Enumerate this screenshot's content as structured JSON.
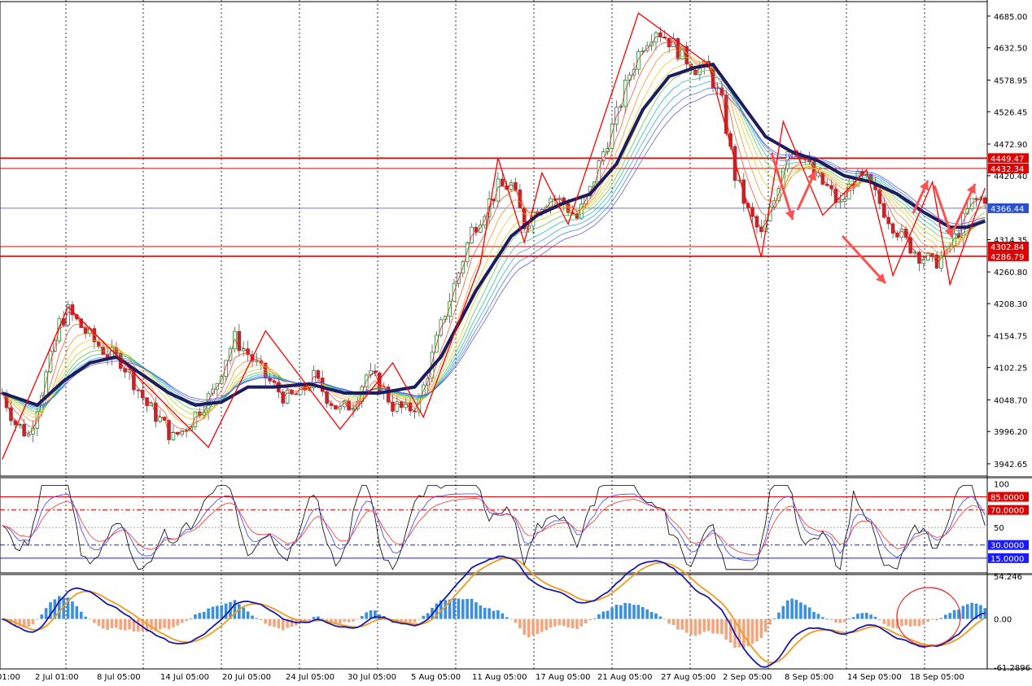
{
  "chart_data": [
    {
      "panel": "price",
      "type": "candlestick",
      "y_ticks": [
        "4685.00",
        "4632.50",
        "4578.95",
        "4526.45",
        "4472.90",
        "4420.40",
        "4366.44",
        "4314.35",
        "4260.80",
        "4208.30",
        "4154.75",
        "4102.25",
        "4048.70",
        "3996.20",
        "3942.65"
      ],
      "ylim": [
        3925,
        4705
      ],
      "x_ticks": [
        "01:00",
        "2 Jul 01:00",
        "8 Jul 05:00",
        "14 Jul 05:00",
        "20 Jul 05:00",
        "24 Jul 05:00",
        "30 Jul 05:00",
        "5 Aug 05:00",
        "11 Aug 05:00",
        "17 Aug 05:00",
        "21 Aug 05:00",
        "27 Aug 05:00",
        "2 Sep 05:00",
        "8 Sep 05:00",
        "14 Sep 05:00",
        "18 Sep 05:00"
      ],
      "close_anchors": [
        [
          0,
          4060
        ],
        [
          3,
          4010
        ],
        [
          6,
          3990
        ],
        [
          9,
          4065
        ],
        [
          11,
          4115
        ],
        [
          13,
          4175
        ],
        [
          15,
          4195
        ],
        [
          18,
          4170
        ],
        [
          21,
          4145
        ],
        [
          24,
          4125
        ],
        [
          27,
          4115
        ],
        [
          30,
          4080
        ],
        [
          33,
          4040
        ],
        [
          36,
          4015
        ],
        [
          39,
          3985
        ],
        [
          42,
          4005
        ],
        [
          45,
          4035
        ],
        [
          48,
          4060
        ],
        [
          51,
          4120
        ],
        [
          53,
          4150
        ],
        [
          56,
          4125
        ],
        [
          59,
          4095
        ],
        [
          62,
          4070
        ],
        [
          65,
          4050
        ],
        [
          68,
          4060
        ],
        [
          71,
          4085
        ],
        [
          74,
          4055
        ],
        [
          77,
          4030
        ],
        [
          80,
          4045
        ],
        [
          83,
          4090
        ],
        [
          86,
          4075
        ],
        [
          89,
          4040
        ],
        [
          92,
          4030
        ],
        [
          95,
          4045
        ],
        [
          98,
          4120
        ],
        [
          101,
          4195
        ],
        [
          104,
          4260
        ],
        [
          107,
          4330
        ],
        [
          110,
          4365
        ],
        [
          113,
          4400
        ],
        [
          116,
          4405
        ],
        [
          119,
          4340
        ],
        [
          122,
          4370
        ],
        [
          125,
          4385
        ],
        [
          128,
          4375
        ],
        [
          131,
          4350
        ],
        [
          134,
          4395
        ],
        [
          137,
          4460
        ],
        [
          140,
          4520
        ],
        [
          143,
          4590
        ],
        [
          146,
          4640
        ],
        [
          149,
          4665
        ],
        [
          152,
          4645
        ],
        [
          155,
          4620
        ],
        [
          158,
          4600
        ],
        [
          161,
          4595
        ],
        [
          164,
          4540
        ],
        [
          167,
          4420
        ],
        [
          170,
          4360
        ],
        [
          173,
          4320
        ],
        [
          176,
          4380
        ],
        [
          179,
          4470
        ],
        [
          182,
          4460
        ],
        [
          185,
          4420
        ],
        [
          188,
          4400
        ],
        [
          191,
          4370
        ],
        [
          194,
          4415
        ],
        [
          197,
          4410
        ],
        [
          200,
          4375
        ],
        [
          203,
          4340
        ],
        [
          206,
          4310
        ],
        [
          209,
          4290
        ],
        [
          212,
          4275
        ],
        [
          215,
          4290
        ],
        [
          218,
          4330
        ],
        [
          221,
          4375
        ],
        [
          224,
          4385
        ]
      ],
      "ema_thick_anchors": [
        [
          0,
          4060
        ],
        [
          8,
          4040
        ],
        [
          14,
          4080
        ],
        [
          20,
          4110
        ],
        [
          26,
          4120
        ],
        [
          32,
          4090
        ],
        [
          38,
          4060
        ],
        [
          44,
          4040
        ],
        [
          50,
          4045
        ],
        [
          56,
          4070
        ],
        [
          62,
          4070
        ],
        [
          70,
          4075
        ],
        [
          78,
          4060
        ],
        [
          86,
          4060
        ],
        [
          94,
          4070
        ],
        [
          100,
          4120
        ],
        [
          108,
          4230
        ],
        [
          116,
          4320
        ],
        [
          122,
          4355
        ],
        [
          128,
          4375
        ],
        [
          134,
          4390
        ],
        [
          140,
          4440
        ],
        [
          146,
          4530
        ],
        [
          152,
          4585
        ],
        [
          158,
          4600
        ],
        [
          162,
          4605
        ],
        [
          168,
          4545
        ],
        [
          174,
          4485
        ],
        [
          180,
          4460
        ],
        [
          186,
          4445
        ],
        [
          192,
          4420
        ],
        [
          198,
          4410
        ],
        [
          204,
          4390
        ],
        [
          210,
          4360
        ],
        [
          216,
          4335
        ],
        [
          220,
          4335
        ],
        [
          224,
          4345
        ]
      ],
      "horizontal_levels": [
        {
          "value": 4449.47,
          "label": "4449.47",
          "color": "#e00000"
        },
        {
          "value": 4432.34,
          "label": "4432.34",
          "color": "#e00000"
        },
        {
          "value": 4366.44,
          "label": "4366.44",
          "color": "#2a4fd0"
        },
        {
          "value": 4302.84,
          "label": "4302.84",
          "color": "#e00000"
        },
        {
          "value": 4286.79,
          "label": "4286.79",
          "color": "#e00000"
        }
      ],
      "zigzag": [
        [
          0,
          3950
        ],
        [
          15,
          4203
        ],
        [
          47,
          3970
        ],
        [
          60,
          4163
        ],
        [
          77,
          4000
        ],
        [
          89,
          4110
        ],
        [
          96,
          4020
        ],
        [
          109,
          4275
        ],
        [
          113,
          4450
        ],
        [
          119,
          4310
        ],
        [
          123,
          4425
        ],
        [
          129,
          4340
        ],
        [
          145,
          4690
        ],
        [
          161,
          4605
        ],
        [
          173,
          4285
        ],
        [
          178,
          4510
        ],
        [
          187,
          4355
        ],
        [
          197,
          4430
        ],
        [
          203,
          4255
        ],
        [
          212,
          4410
        ],
        [
          216,
          4240
        ],
        [
          224,
          4400
        ]
      ],
      "colors": {
        "bull": "#1b8a2e",
        "bear": "#c0272d",
        "ema_thick": "#1c1c5e",
        "zigzag": "#ff0000",
        "arrows": "#ff5050",
        "grid": "#000000"
      }
    },
    {
      "panel": "stochastic",
      "type": "line",
      "y_ticks": [
        "100",
        "50"
      ],
      "levels": [
        {
          "value": 85,
          "label": "85.0000",
          "color": "#e00000"
        },
        {
          "value": 70,
          "label": "70.0000",
          "color": "#e00000"
        },
        {
          "value": 30,
          "label": "30.0000",
          "color": "#1a1aff"
        },
        {
          "value": 15,
          "label": "15.0000",
          "color": "#1a1aff"
        }
      ],
      "ylim": [
        0,
        105
      ],
      "series_colors": [
        "#000000",
        "#3b3bff",
        "#ff3030"
      ]
    },
    {
      "panel": "macd",
      "type": "bar+line",
      "y_ticks": [
        "54.246",
        "0.00",
        "-61.2896"
      ],
      "ylim": [
        -61.2896,
        54.246
      ],
      "colors": {
        "pos": "#3a8fe0",
        "neg": "#f4a57e",
        "fast": "#1a1aaa",
        "slow": "#f29a1e",
        "circle": "#e03030"
      }
    }
  ]
}
